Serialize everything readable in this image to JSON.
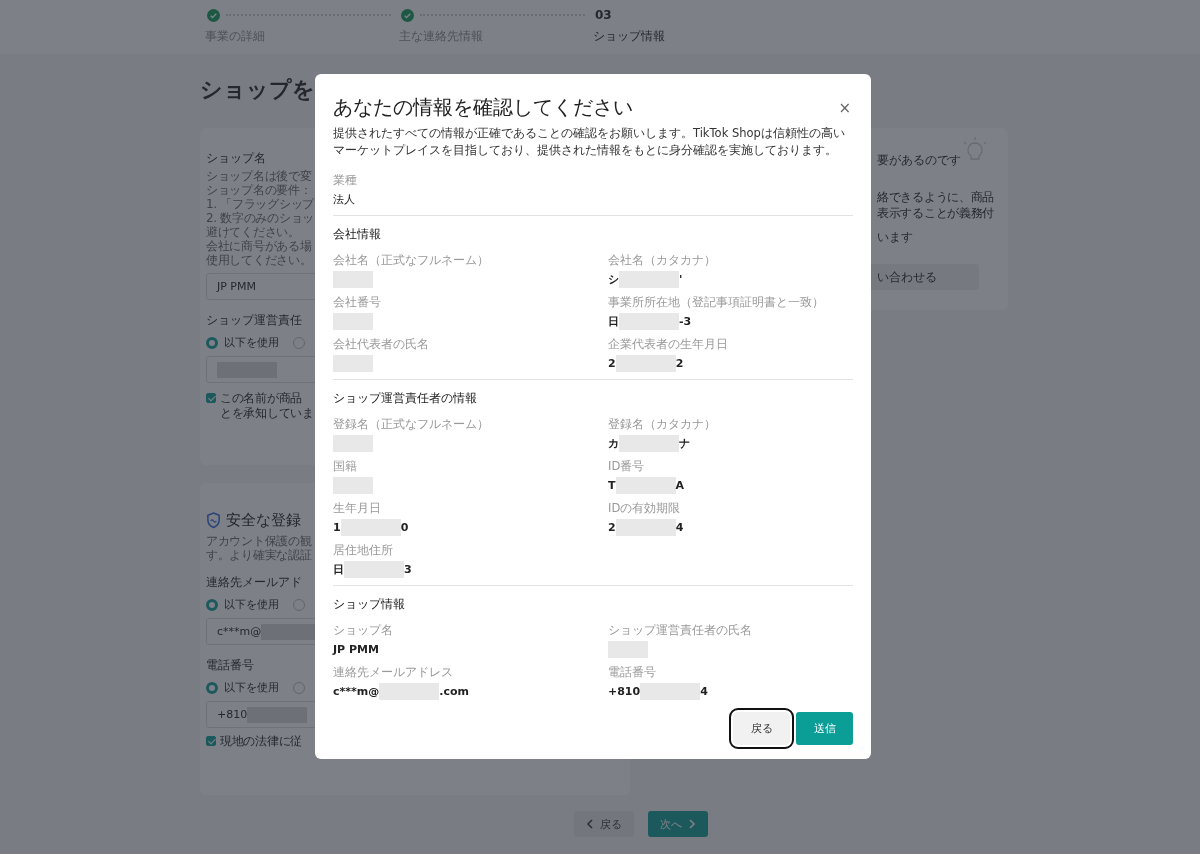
{
  "stepper": {
    "steps": [
      {
        "label": "事業の詳細",
        "done": true
      },
      {
        "label": "主な連絡先情報",
        "done": true
      },
      {
        "number": "03",
        "label": "ショップ情報",
        "done": false
      }
    ]
  },
  "page": {
    "title": "ショップを",
    "shop_card": {
      "label": "ショップ名",
      "description": [
        "ショップ名は後で変",
        "ショップ名の要件：",
        "1. 「フラッグシップ",
        "2. 数字のみのショッ",
        "避けてください。",
        "会社に商号がある場",
        "使用してください。"
      ],
      "input": {
        "value": "JP PMM"
      },
      "manager_label": "ショップ運営責任",
      "radios": [
        {
          "label": "以下を使用",
          "selected": true
        },
        {
          "selected": false
        }
      ],
      "manager_input": {
        "redacted": true
      },
      "checkbox": {
        "lines": [
          "この名前が商品",
          "とを承知していま"
        ],
        "checked": true
      }
    },
    "security_card": {
      "title": "安全な登録",
      "description": [
        "アカウント保護の観",
        "す。より確実な認証"
      ],
      "groups": [
        {
          "label": "連絡先メールアド",
          "radios": [
            {
              "label": "以下を使用",
              "selected": true
            },
            {
              "selected": false
            }
          ],
          "input": {
            "value": "c***m@",
            "redacted": true
          }
        },
        {
          "label": "電話番号",
          "radios": [
            {
              "label": "以下を使用",
              "selected": true
            },
            {
              "selected": false
            }
          ],
          "input": {
            "value": "+810",
            "redacted": true
          }
        }
      ],
      "checkbox": {
        "lines": [
          "現地の法律に従"
        ],
        "checked": true
      }
    },
    "help_card": {
      "title": "要があるのです",
      "lines": [
        "絡できるように、商品",
        "表示することが義務付"
      ],
      "note": "います",
      "button": "い合わせる"
    },
    "footer": {
      "back": "戻る",
      "next": "次へ"
    }
  },
  "modal": {
    "title": "あなたの情報を確認してください",
    "close": "×",
    "description": "提供されたすべての情報が正確であることの確認をお願いします。TikTok Shopは信頼性の高いマーケットプレイスを目指しており、提供された情報をもとに身分確認を実施しております。",
    "sections": [
      {
        "fields": [
          {
            "label": "業種",
            "value": {
              "start": "法人"
            }
          }
        ]
      },
      {
        "heading": "会社情報",
        "fields": [
          {
            "label": "会社名（正式なフルネーム）",
            "value": {
              "redacted": true
            }
          },
          {
            "label": "会社名（カタカナ）",
            "value": {
              "start": "シ",
              "redacted": true,
              "end": "'"
            }
          },
          {
            "label": "会社番号",
            "value": {
              "redacted": true
            }
          },
          {
            "label": "事業所所在地（登記事項証明書と一致）",
            "value": {
              "start": "日",
              "redacted": true,
              "end": "-3"
            }
          },
          {
            "label": "会社代表者の氏名",
            "value": {
              "redacted": true
            }
          },
          {
            "label": "企業代表者の生年月日",
            "value": {
              "start": "2",
              "redacted": true,
              "end": "2"
            }
          }
        ]
      },
      {
        "heading": "ショップ運営責任者の情報",
        "fields": [
          {
            "label": "登録名（正式なフルネーム）",
            "value": {
              "redacted": true
            }
          },
          {
            "label": "登録名（カタカナ）",
            "value": {
              "start": "カ",
              "redacted": true,
              "end": "ナ"
            }
          },
          {
            "label": "国籍",
            "value": {
              "redacted": true
            }
          },
          {
            "label": "ID番号",
            "value": {
              "start": "T",
              "redacted": true,
              "end": "A"
            }
          },
          {
            "label": "生年月日",
            "value": {
              "start": "1",
              "redacted": true,
              "end": "0"
            }
          },
          {
            "label": "IDの有効期限",
            "value": {
              "start": "2",
              "redacted": true,
              "end": "4"
            }
          },
          {
            "label": "居住地住所",
            "value": {
              "start": "日",
              "redacted": true,
              "end": "3"
            }
          }
        ]
      },
      {
        "heading": "ショップ情報",
        "fields": [
          {
            "label": "ショップ名",
            "value": {
              "start": "JP PMM"
            }
          },
          {
            "label": "ショップ運営責任者の氏名",
            "value": {
              "redacted": true
            }
          },
          {
            "label": "連絡先メールアドレス",
            "value": {
              "start": "c***m@",
              "redacted": true,
              "end": ".com"
            }
          },
          {
            "label": "電話番号",
            "value": {
              "start": "+810",
              "redacted": true,
              "end": "4"
            }
          }
        ]
      }
    ],
    "buttons": [
      {
        "label": "戻る",
        "kind": "secondary",
        "focused": true
      },
      {
        "label": "送信",
        "kind": "primary",
        "focused": false
      }
    ]
  }
}
